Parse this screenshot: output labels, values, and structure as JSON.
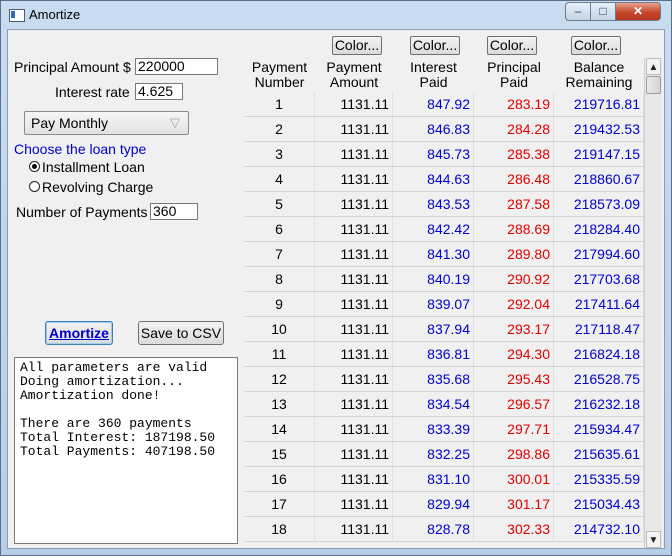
{
  "window": {
    "title": "Amortize",
    "controls": {
      "minimize": "–",
      "maximize": "□",
      "close": "✕"
    }
  },
  "form": {
    "principal_label": "Principal Amount $",
    "principal_value": "220000",
    "rate_label": "Interest rate",
    "rate_value": "4.625",
    "frequency_selected": "Pay Monthly",
    "loan_type_heading": "Choose the loan type",
    "loan_types": [
      {
        "label": "Installment Loan",
        "selected": true
      },
      {
        "label": "Revolving Charge",
        "selected": false
      }
    ],
    "payments_label": "Number of Payments",
    "payments_value": "360"
  },
  "buttons": {
    "amortize": "Amortize",
    "save_csv": "Save to CSV",
    "color": "Color..."
  },
  "log": {
    "text": "All parameters are valid\nDoing amortization...\nAmortization done!\n\nThere are 360 payments\nTotal Interest: 187198.50\nTotal Payments: 407198.50"
  },
  "table": {
    "headers": [
      "Payment\nNumber",
      "Payment\nAmount",
      "Interest\nPaid",
      "Principal\nPaid",
      "Balance\nRemaining"
    ],
    "colors": {
      "interest": "#0000cc",
      "principal": "#e00000",
      "balance": "#0000cc"
    },
    "rows": [
      [
        "1",
        "1131.11",
        "847.92",
        "283.19",
        "219716.81"
      ],
      [
        "2",
        "1131.11",
        "846.83",
        "284.28",
        "219432.53"
      ],
      [
        "3",
        "1131.11",
        "845.73",
        "285.38",
        "219147.15"
      ],
      [
        "4",
        "1131.11",
        "844.63",
        "286.48",
        "218860.67"
      ],
      [
        "5",
        "1131.11",
        "843.53",
        "287.58",
        "218573.09"
      ],
      [
        "6",
        "1131.11",
        "842.42",
        "288.69",
        "218284.40"
      ],
      [
        "7",
        "1131.11",
        "841.30",
        "289.80",
        "217994.60"
      ],
      [
        "8",
        "1131.11",
        "840.19",
        "290.92",
        "217703.68"
      ],
      [
        "9",
        "1131.11",
        "839.07",
        "292.04",
        "217411.64"
      ],
      [
        "10",
        "1131.11",
        "837.94",
        "293.17",
        "217118.47"
      ],
      [
        "11",
        "1131.11",
        "836.81",
        "294.30",
        "216824.18"
      ],
      [
        "12",
        "1131.11",
        "835.68",
        "295.43",
        "216528.75"
      ],
      [
        "13",
        "1131.11",
        "834.54",
        "296.57",
        "216232.18"
      ],
      [
        "14",
        "1131.11",
        "833.39",
        "297.71",
        "215934.47"
      ],
      [
        "15",
        "1131.11",
        "832.25",
        "298.86",
        "215635.61"
      ],
      [
        "16",
        "1131.11",
        "831.10",
        "300.01",
        "215335.59"
      ],
      [
        "17",
        "1131.11",
        "829.94",
        "301.17",
        "215034.43"
      ],
      [
        "18",
        "1131.11",
        "828.78",
        "302.33",
        "214732.10"
      ]
    ]
  }
}
